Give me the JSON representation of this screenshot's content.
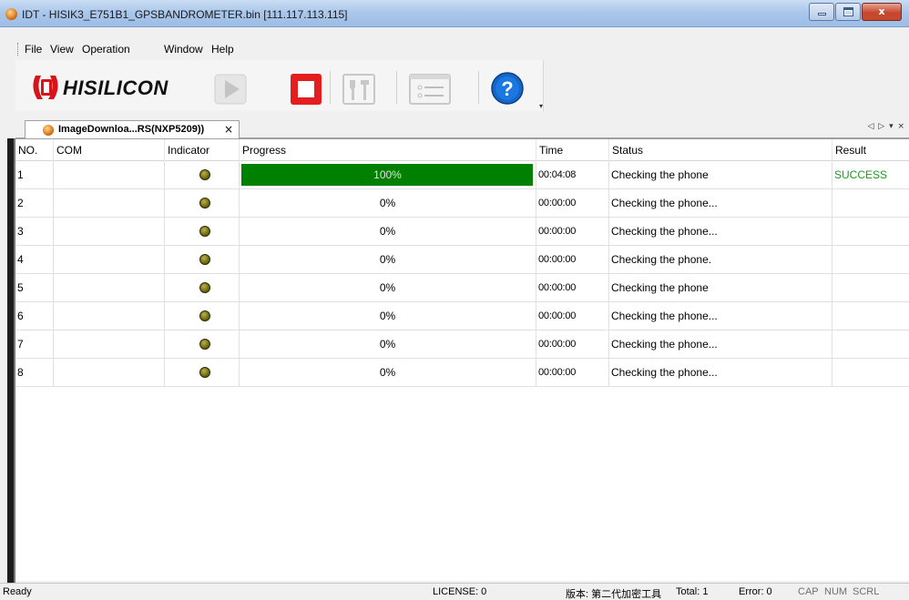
{
  "window": {
    "title": "IDT - HISIK3_E751B1_GPSBANDROMETER.bin [111.117.113.115]",
    "min_label": "",
    "max_label": "",
    "close_label": "x"
  },
  "menu": [
    "File",
    "View",
    "Operation",
    "Window",
    "Help"
  ],
  "toolbar": {
    "logo_text": "HISILICON",
    "buttons": [
      "play-icon",
      "stop-icon",
      "tools-icon",
      "settings-panel-icon",
      "help-icon"
    ],
    "help_glyph": "?"
  },
  "tab": {
    "label": "ImageDownloa...RS(NXP5209))",
    "close": "×",
    "nav": "◁ ▷ ▾ ×"
  },
  "columns": [
    "NO.",
    "COM",
    "Indicator",
    "Progress",
    "Time",
    "Status",
    "Result"
  ],
  "rows": [
    {
      "no": "1",
      "com": "",
      "progress": 1.0,
      "progress_text": "100%",
      "time": "00:04:08",
      "status": "Checking the phone",
      "result": "SUCCESS"
    },
    {
      "no": "2",
      "com": "",
      "progress": 0,
      "progress_text": "0%",
      "time": "00:00:00",
      "status": "Checking the phone...",
      "result": ""
    },
    {
      "no": "3",
      "com": "",
      "progress": 0,
      "progress_text": "0%",
      "time": "00:00:00",
      "status": "Checking the phone...",
      "result": ""
    },
    {
      "no": "4",
      "com": "",
      "progress": 0,
      "progress_text": "0%",
      "time": "00:00:00",
      "status": "Checking the phone.",
      "result": ""
    },
    {
      "no": "5",
      "com": "",
      "progress": 0,
      "progress_text": "0%",
      "time": "00:00:00",
      "status": "Checking the phone",
      "result": ""
    },
    {
      "no": "6",
      "com": "",
      "progress": 0,
      "progress_text": "0%",
      "time": "00:00:00",
      "status": "Checking the phone...",
      "result": ""
    },
    {
      "no": "7",
      "com": "",
      "progress": 0,
      "progress_text": "0%",
      "time": "00:00:00",
      "status": "Checking the phone...",
      "result": ""
    },
    {
      "no": "8",
      "com": "",
      "progress": 0,
      "progress_text": "0%",
      "time": "00:00:00",
      "status": "Checking the phone...",
      "result": ""
    }
  ],
  "statusbar": {
    "ready": "Ready",
    "license": "LICENSE: 0",
    "version": "版本: 第二代加密工具",
    "total": "Total: 1",
    "error": "Error: 0",
    "cap": "CAP",
    "num": "NUM",
    "scrl": "SCRL"
  },
  "colors": {
    "progress_fill": "#008000",
    "success": "#1c9a1c",
    "stop": "#e41e1e",
    "help": "#1466c8"
  }
}
